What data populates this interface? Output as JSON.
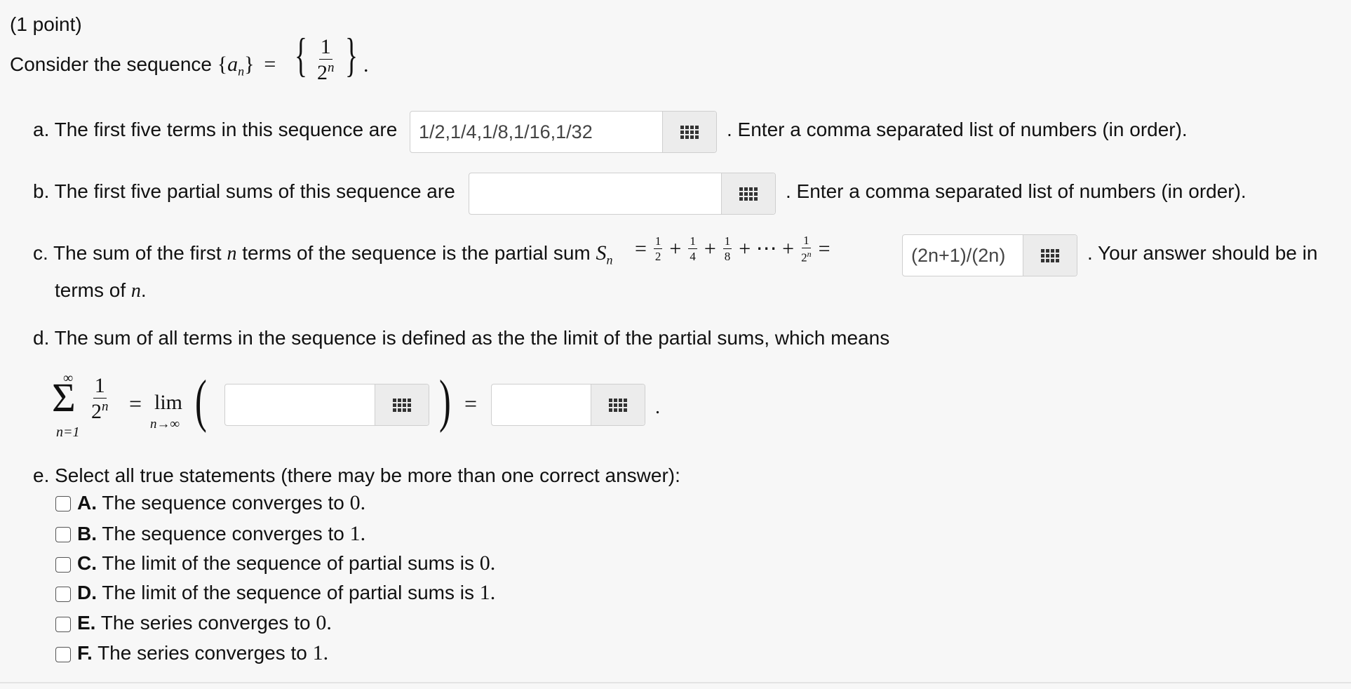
{
  "problem": {
    "points": "(1 point)",
    "intro_prefix": "Consider the sequence",
    "seq_a": "a",
    "seq_n": "n",
    "frac_num": "1",
    "frac_den_base": "2",
    "frac_den_exp": "n"
  },
  "part_a": {
    "prefix": "a. The first five terms in this sequence are",
    "value": "1/2,1/4,1/8,1/16,1/32",
    "suffix": ". Enter a comma separated list of numbers (in order)."
  },
  "part_b": {
    "prefix": "b. The first five partial sums of this sequence are",
    "value": "",
    "suffix": ". Enter a comma separated list of numbers (in order)."
  },
  "part_c": {
    "prefix": "c. The sum of the first",
    "var_n": "n",
    "middle": "terms of the sequence is the partial sum",
    "sum_S": "S",
    "sum_sub": "n",
    "value": "(2n+1)/(2n)",
    "suffix": ". Your answer should be in",
    "line2": "terms of",
    "line2_var": "n",
    "line2_end": "."
  },
  "part_d": {
    "text": "d. The sum of all terms in the sequence is defined as the the limit of the partial sums, which means",
    "sigma_top": "∞",
    "sigma_bottom": "n=1",
    "lim": "lim",
    "lim_sub": "n→∞",
    "value_limit": "",
    "value_sum": ""
  },
  "part_e": {
    "prompt": "e. Select all true statements (there may be more than one correct answer):",
    "options": [
      {
        "letter": "A.",
        "text": "The sequence converges to",
        "val": "0.",
        "checked": false
      },
      {
        "letter": "B.",
        "text": "The sequence converges to",
        "val": "1.",
        "checked": false
      },
      {
        "letter": "C.",
        "text": "The limit of the sequence of partial sums is",
        "val": "0.",
        "checked": false
      },
      {
        "letter": "D.",
        "text": "The limit of the sequence of partial sums is",
        "val": "1.",
        "checked": false
      },
      {
        "letter": "E.",
        "text": "The series converges to",
        "val": "0.",
        "checked": false
      },
      {
        "letter": "F.",
        "text": "The series converges to",
        "val": "1.",
        "checked": false
      }
    ]
  },
  "icons": {
    "equation_editor": "grid-icon"
  }
}
